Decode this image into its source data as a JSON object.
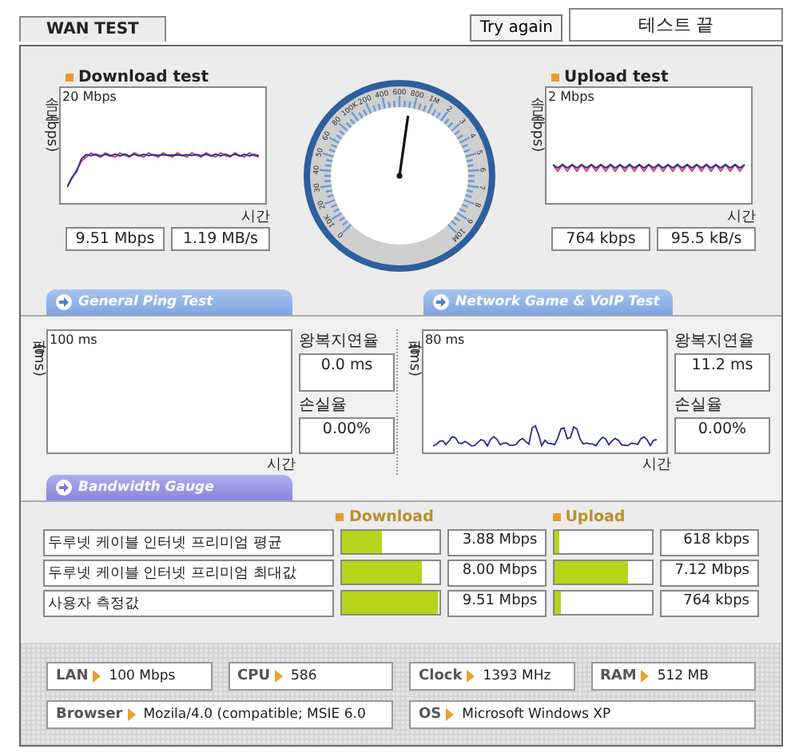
{
  "window_tabs": [
    {
      "label": "WAN TEST",
      "selected": true
    }
  ],
  "try_again_button": "Try again",
  "status": "테스트 끝",
  "speed_tests": [
    {
      "title": "Download test",
      "axis_label": "속도(bps)",
      "scale": "20 Mbps",
      "time_label": "시간",
      "readings": [
        "9.51 Mbps",
        "1.19 MB/s"
      ]
    },
    {
      "title": "Upload test",
      "axis_label": "속도(bps)",
      "scale": "2 Mbps",
      "time_label": "시간",
      "readings": [
        "764 kbps",
        "95.5 kB/s"
      ]
    }
  ],
  "gauge": {
    "labels": [
      "0",
      "10K",
      "20",
      "30",
      "40",
      "50",
      "60",
      "80",
      "100K",
      "200",
      "400",
      "600",
      "800",
      "1M",
      "2",
      "3",
      "4",
      "5",
      "6",
      "7",
      "8",
      "9",
      "10M"
    ],
    "level": 0.53
  },
  "ping_tests": [
    {
      "tab": "General Ping Test",
      "axis_label": "핑(ms)",
      "scale": "100 ms",
      "time_label": "시간",
      "latency_label": "왕복지연율",
      "latency": "0.0 ms",
      "loss_label": "손실율",
      "loss": "0.00%"
    },
    {
      "tab": "Network Game & VoIP Test",
      "axis_label": "핑(ms)",
      "scale": "80 ms",
      "time_label": "시간",
      "latency_label": "왕복지연율",
      "latency": "11.2 ms",
      "loss_label": "손실율",
      "loss": "0.00%"
    }
  ],
  "bandwidth": {
    "tab": "Bandwidth Gauge",
    "columns": [
      "Download",
      "Upload"
    ],
    "rows": [
      {
        "label": "두루넷 케이블 인터넷 프리미엄 평균",
        "download": {
          "level": 0.4,
          "value": "3.88 Mbps"
        },
        "upload": {
          "level": 0.05,
          "value": "618 kbps"
        }
      },
      {
        "label": "두루넷 케이블 인터넷 프리미엄 최대값",
        "download": {
          "level": 0.82,
          "value": "8.00 Mbps"
        },
        "upload": {
          "level": 0.75,
          "value": "7.12 Mbps"
        }
      },
      {
        "label": "사용자 측정값",
        "download": {
          "level": 0.98,
          "value": "9.51 Mbps"
        },
        "upload": {
          "level": 0.07,
          "value": "764 kbps"
        }
      }
    ]
  },
  "system_info": [
    {
      "label": "LAN",
      "value": "100 Mbps"
    },
    {
      "label": "CPU",
      "value": "586"
    },
    {
      "label": "Clock",
      "value": "1393 MHz"
    },
    {
      "label": "RAM",
      "value": "512 MB"
    },
    {
      "label": "Browser",
      "value": "Mozila/4.0 (compatible; MSIE 6.0"
    },
    {
      "label": "OS",
      "value": "Microsoft Windows XP"
    }
  ]
}
